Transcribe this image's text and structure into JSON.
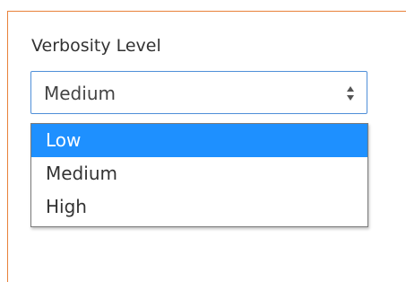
{
  "field": {
    "label": "Verbosity Level",
    "selected_value": "Medium"
  },
  "dropdown": {
    "options": [
      {
        "label": "Low",
        "highlighted": true
      },
      {
        "label": "Medium",
        "highlighted": false
      },
      {
        "label": "High",
        "highlighted": false
      }
    ]
  },
  "colors": {
    "panel_border": "#e8823a",
    "select_border": "#4f8fd8",
    "highlight": "#1e90ff"
  },
  "icons": {
    "select_arrows": "up-down-arrows-icon"
  }
}
